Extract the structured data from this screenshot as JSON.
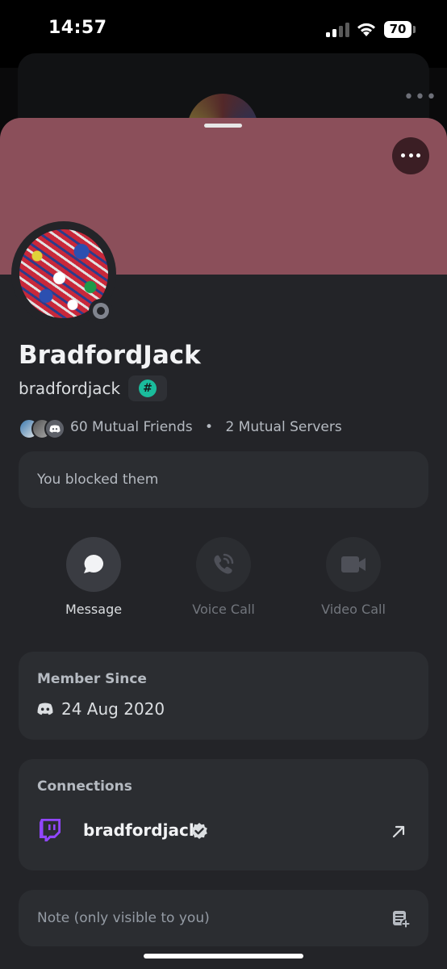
{
  "status_bar": {
    "time": "14:57",
    "battery": "70"
  },
  "profile": {
    "display_name": "BradfordJack",
    "username": "bradfordjack",
    "tag_symbol": "#",
    "mutual_friends": "60 Mutual Friends",
    "separator": "•",
    "mutual_servers": "2 Mutual Servers",
    "banner_color": "#8b4f5a",
    "status": "offline"
  },
  "blocked_notice": "You blocked them",
  "actions": [
    {
      "label": "Message",
      "icon": "chat-bubble-icon",
      "enabled": true
    },
    {
      "label": "Voice Call",
      "icon": "phone-icon",
      "enabled": false
    },
    {
      "label": "Video Call",
      "icon": "video-camera-icon",
      "enabled": false
    }
  ],
  "member_since": {
    "title": "Member Since",
    "date": "24 Aug 2020",
    "icon": "discord-logo-icon"
  },
  "connections": {
    "title": "Connections",
    "items": [
      {
        "service": "twitch",
        "name": "bradfordjack",
        "verified": true,
        "icon": "twitch-icon"
      }
    ]
  },
  "note": {
    "placeholder": "Note (only visible to you)",
    "icon": "note-add-icon"
  }
}
